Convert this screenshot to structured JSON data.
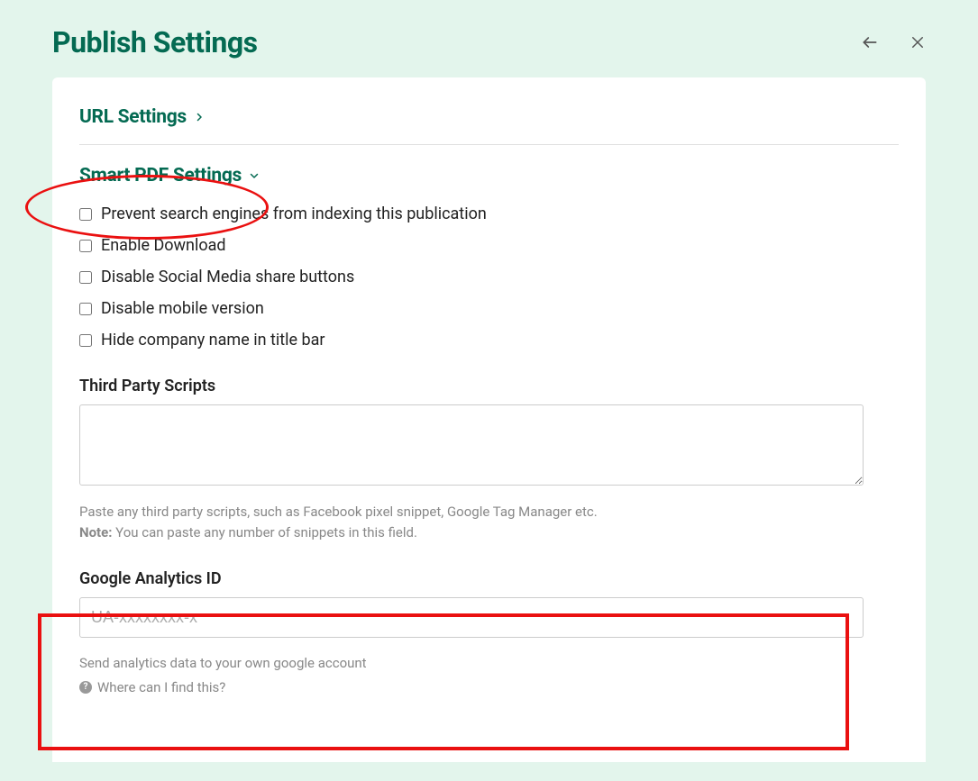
{
  "header": {
    "title": "Publish Settings"
  },
  "sections": {
    "url": {
      "title": "URL Settings"
    },
    "smart": {
      "title": "Smart PDF Settings"
    }
  },
  "checkboxes": [
    {
      "label": "Prevent search engines from indexing this publication"
    },
    {
      "label": "Enable Download"
    },
    {
      "label": "Disable Social Media share buttons"
    },
    {
      "label": "Disable mobile version"
    },
    {
      "label": "Hide company name in title bar"
    }
  ],
  "scripts": {
    "label": "Third Party Scripts",
    "value": "",
    "help_line1": "Paste any third party scripts, such as Facebook pixel snippet, Google Tag Manager etc.",
    "note_label": "Note:",
    "note_text": " You can paste any number of snippets in this field."
  },
  "ga": {
    "label": "Google Analytics ID",
    "placeholder": "UA-xxxxxxxx-x",
    "value": "",
    "help": "Send analytics data to your own google account",
    "find_link": "Where can I find this?"
  }
}
